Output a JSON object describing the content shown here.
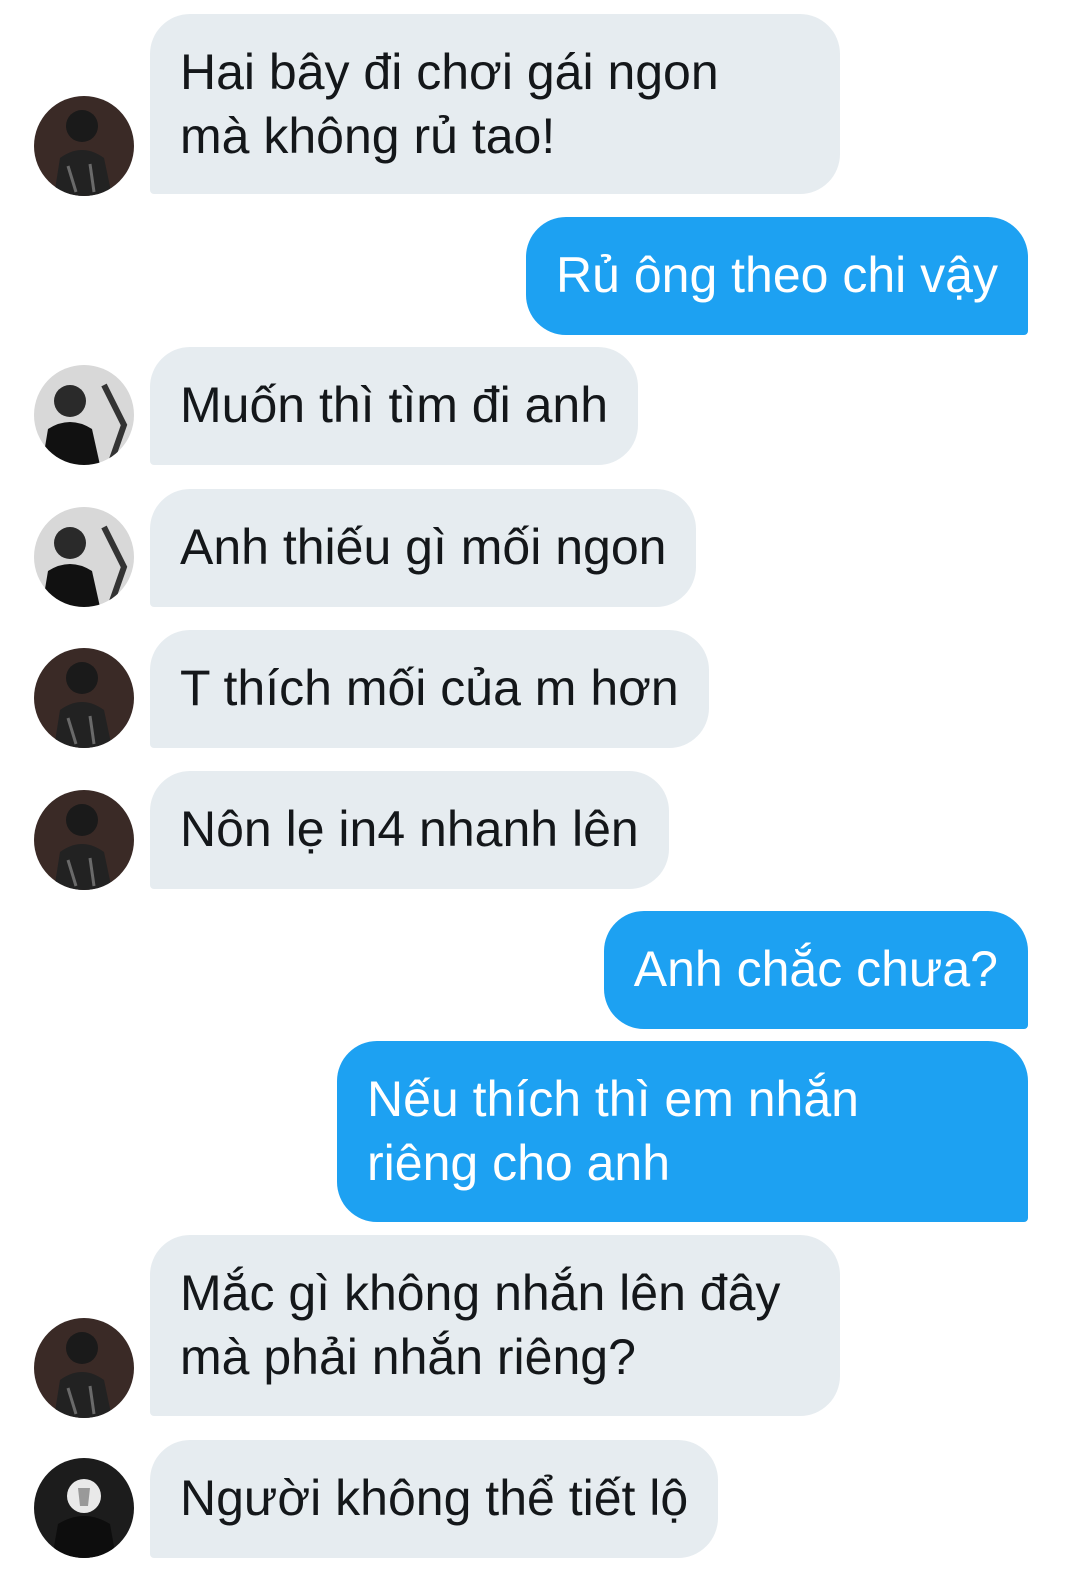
{
  "colors": {
    "incoming_bubble": "#e6ecf0",
    "outgoing_bubble": "#1da1f2",
    "incoming_text": "#14171a",
    "outgoing_text": "#ffffff"
  },
  "messages": [
    {
      "direction": "incoming",
      "avatar": "user-a-avatar",
      "lines": [
        "Hai bây đi chơi gái ngon",
        "mà không rủ tao!"
      ]
    },
    {
      "direction": "outgoing",
      "lines": [
        "Rủ ông theo chi vậy"
      ]
    },
    {
      "direction": "incoming",
      "avatar": "user-b-avatar",
      "lines": [
        "Muốn thì tìm đi anh"
      ]
    },
    {
      "direction": "incoming",
      "avatar": "user-b-avatar",
      "lines": [
        "Anh thiếu gì mối ngon"
      ]
    },
    {
      "direction": "incoming",
      "avatar": "user-a-avatar",
      "lines": [
        "T thích mối của m hơn"
      ]
    },
    {
      "direction": "incoming",
      "avatar": "user-a-avatar",
      "lines": [
        "Nôn lẹ in4 nhanh lên"
      ]
    },
    {
      "direction": "outgoing",
      "lines": [
        "Anh chắc chưa?"
      ]
    },
    {
      "direction": "outgoing",
      "lines": [
        "Nếu thích thì em nhắn",
        "riêng cho anh"
      ]
    },
    {
      "direction": "incoming",
      "avatar": "user-a-avatar",
      "lines": [
        "Mắc gì không nhắn lên đây",
        "mà phải nhắn riêng?"
      ]
    },
    {
      "direction": "incoming",
      "avatar": "user-c-avatar",
      "lines": [
        "Người không thể tiết lộ"
      ]
    }
  ]
}
